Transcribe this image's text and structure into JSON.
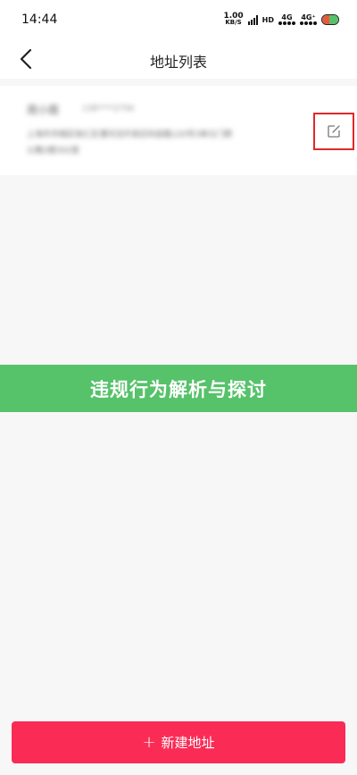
{
  "status_bar": {
    "time": "14:44",
    "net_speed_value": "1.00",
    "net_speed_unit": "KB/S",
    "hd_label": "HD",
    "network1": "4G",
    "network2": "4G⁺"
  },
  "header": {
    "title": "地址列表",
    "back_icon": "chevron-left-icon"
  },
  "address": {
    "name": "周小霞",
    "phone": "138****2756",
    "detail": "上海市市辖区徐汇区漕河泾开发区科技路120号3单元门牌",
    "detail_line2": "公寓2楼302室",
    "edit_icon": "edit-icon",
    "edit_highlight_color": "#e0282a"
  },
  "banner": {
    "text": "违规行为解析与探讨",
    "color": "#56c26a"
  },
  "bottom_button": {
    "label": "新建地址",
    "plus": "+",
    "color": "#fa2c55"
  }
}
